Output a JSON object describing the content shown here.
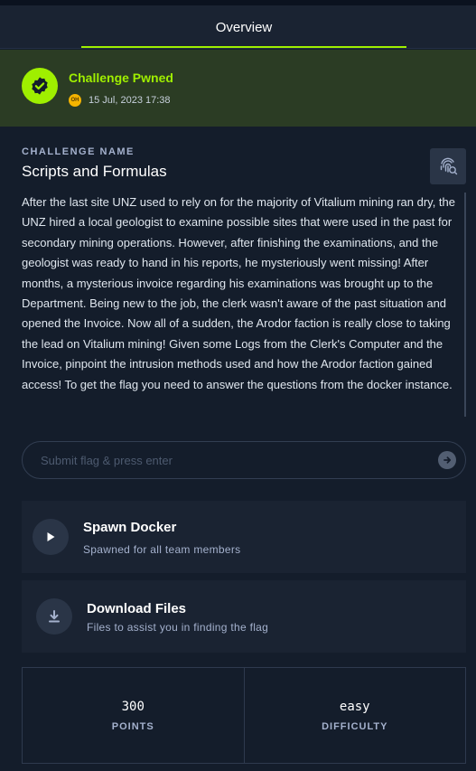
{
  "tabs": {
    "overview": "Overview"
  },
  "pwned": {
    "title": "Challenge Pwned",
    "avatar_initials": "OH",
    "date": "15 Jul, 2023 17:38"
  },
  "challenge": {
    "label": "CHALLENGE NAME",
    "name": "Scripts and Formulas",
    "description": "After the last site UNZ used to rely on for the majority of Vitalium mining ran dry, the UNZ hired a local geologist to examine possible sites that were used in the past for secondary mining operations. However, after finishing the examinations, and the geologist was ready to hand in his reports, he mysteriously went missing! After months, a mysterious invoice regarding his examinations was brought up to the Department. Being new to the job, the clerk wasn't aware of the past situation and opened the Invoice. Now all of a sudden, the Arodor faction is really close to taking the lead on Vitalium mining! Given some Logs from the Clerk's Computer and the Invoice, pinpoint the intrusion methods used and how the Arodor faction gained access! To get the flag you need to answer the questions from the docker instance."
  },
  "flag": {
    "placeholder": "Submit flag & press enter",
    "value": ""
  },
  "spawn": {
    "title": "Spawn Docker",
    "subtitle": "Spawned for all team members"
  },
  "download": {
    "title": "Download Files",
    "subtitle": "Files to assist you in finding the flag"
  },
  "stats": {
    "points_value": "300",
    "points_label": "POINTS",
    "difficulty_value": "easy",
    "difficulty_label": "DIFFICULTY"
  },
  "colors": {
    "accent": "#9fef00",
    "background": "#141d2b",
    "card": "#1a2332",
    "banner": "#2b3c24"
  },
  "icons": {
    "pwned": "verified-check-icon",
    "fingerprint": "fingerprint-search-icon",
    "submit": "arrow-right-circle-icon",
    "spawn": "play-icon",
    "download": "download-icon"
  }
}
